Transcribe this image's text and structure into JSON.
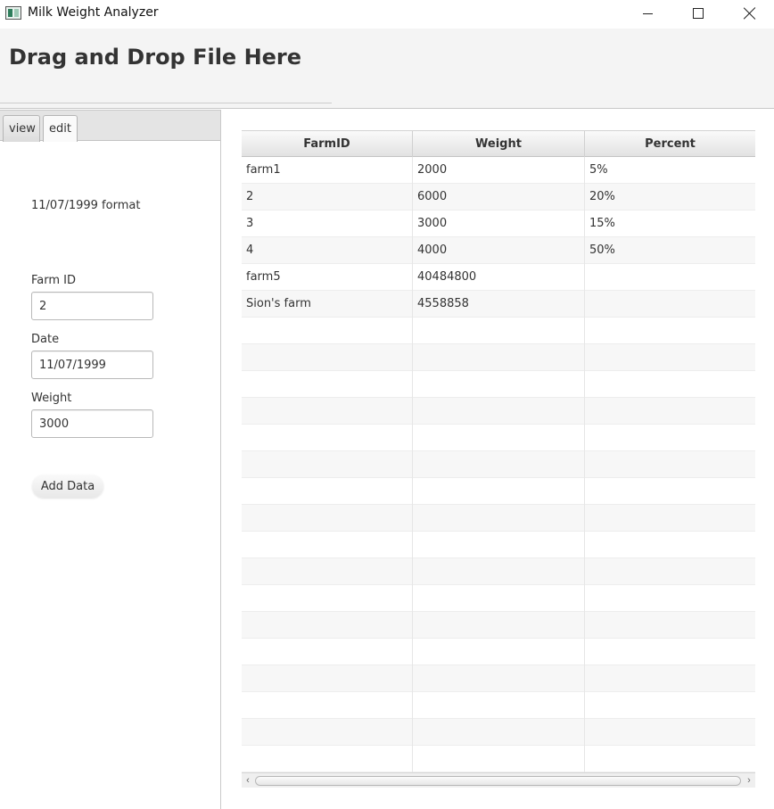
{
  "window": {
    "title": "Milk Weight Analyzer",
    "icon": "app-window-icon",
    "controls": [
      "minimize-icon",
      "maximize-icon",
      "close-icon"
    ]
  },
  "drop_zone": {
    "title": "Drag and Drop File Here"
  },
  "tabs": {
    "view_label": "view",
    "edit_label": "edit",
    "selected": "edit"
  },
  "form": {
    "format_hint": "11/07/1999 format",
    "farm_id_label": "Farm ID",
    "farm_id_value": "2",
    "date_label": "Date",
    "date_value": "11/07/1999",
    "weight_label": "Weight",
    "weight_value": "3000",
    "add_button_label": "Add Data"
  },
  "table": {
    "columns": [
      "FarmID",
      "Weight",
      "Percent"
    ],
    "rows": [
      [
        "farm1",
        "2000",
        "5%"
      ],
      [
        "2",
        "6000",
        "20%"
      ],
      [
        "3",
        "3000",
        "15%"
      ],
      [
        "4",
        "4000",
        "50%"
      ],
      [
        "farm5",
        "40484800",
        ""
      ],
      [
        "Sion's farm",
        "4558858",
        ""
      ]
    ]
  },
  "colors": {
    "header_bg": "#f4f4f4",
    "tab_bar_bg": "#e4e4e4",
    "stripe": "#f7f7f7"
  }
}
